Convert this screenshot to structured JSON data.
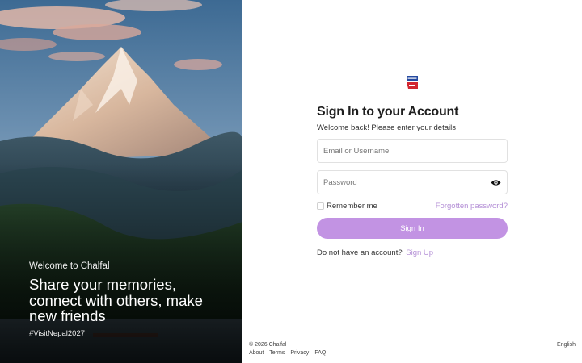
{
  "hero": {
    "image": "mountain-landscape",
    "welcome": "Welcome to Chalfal",
    "headline_lines": [
      "Share your memories,",
      "connect with others, make",
      "new friends"
    ],
    "hashtag": "#VisitNepal2027"
  },
  "brand": {
    "logo_icon": "chalfal-logo-icon",
    "accent": "#c293e3",
    "link_color": "#b48fd6",
    "logo_blue": "#2449a0",
    "logo_red": "#d22630"
  },
  "form": {
    "title": "Sign In to your Account",
    "subtitle": "Welcome back! Please enter your details",
    "email_placeholder": "Email or Username",
    "password_placeholder": "Password",
    "password_toggle_icon": "eye-icon",
    "remember_label": "Remember me",
    "forgot_label": "Forgotten password?",
    "submit_label": "Sign In",
    "signup_prompt": "Do not have an account?",
    "signup_link": "Sign Up"
  },
  "footer": {
    "copyright": "© 2026 Chalfal",
    "links": [
      "About",
      "Terms",
      "Privacy",
      "FAQ"
    ],
    "language": "English"
  }
}
